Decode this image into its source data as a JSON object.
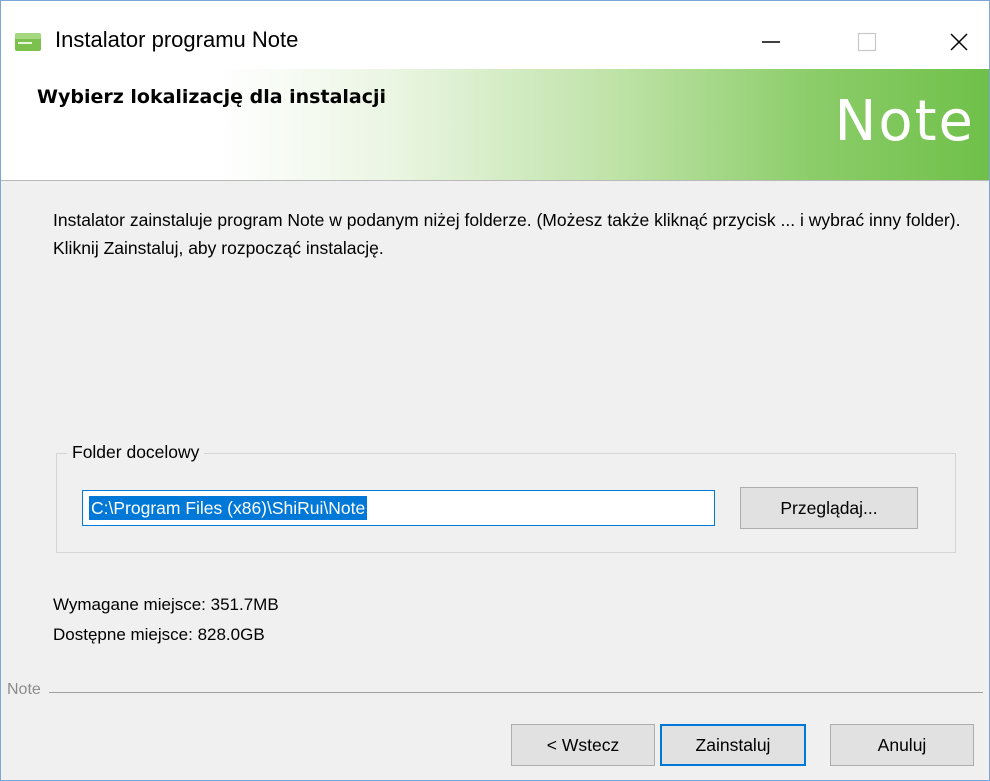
{
  "window": {
    "title": "Instalator programu Note",
    "icon": "note-app-icon",
    "controls": [
      "minimize-icon",
      "maximize-icon",
      "close-icon"
    ]
  },
  "header": {
    "title": "Wybierz lokalizację dla instalacji",
    "logo": "Note"
  },
  "body": {
    "description": "Instalator zainstaluje program Note w podanym niżej folderze. (Możesz także kliknąć przycisk ... i wybrać inny folder). Kliknij Zainstaluj, aby rozpocząć instalację.",
    "destination": {
      "legend": "Folder docelowy",
      "path": "C:\\Program Files (x86)\\ShiRui\\Note",
      "browse_label": "Przeglądaj..."
    },
    "space_required": "Wymagane miejsce: 351.7MB",
    "space_available": "Dostępne miejsce: 828.0GB"
  },
  "footer": {
    "brand": "Note",
    "back_label": "< Wstecz",
    "install_label": "Zainstaluj",
    "cancel_label": "Anuluj"
  },
  "colors": {
    "accent": "#0078d7",
    "banner_green": "#6fc04a"
  }
}
